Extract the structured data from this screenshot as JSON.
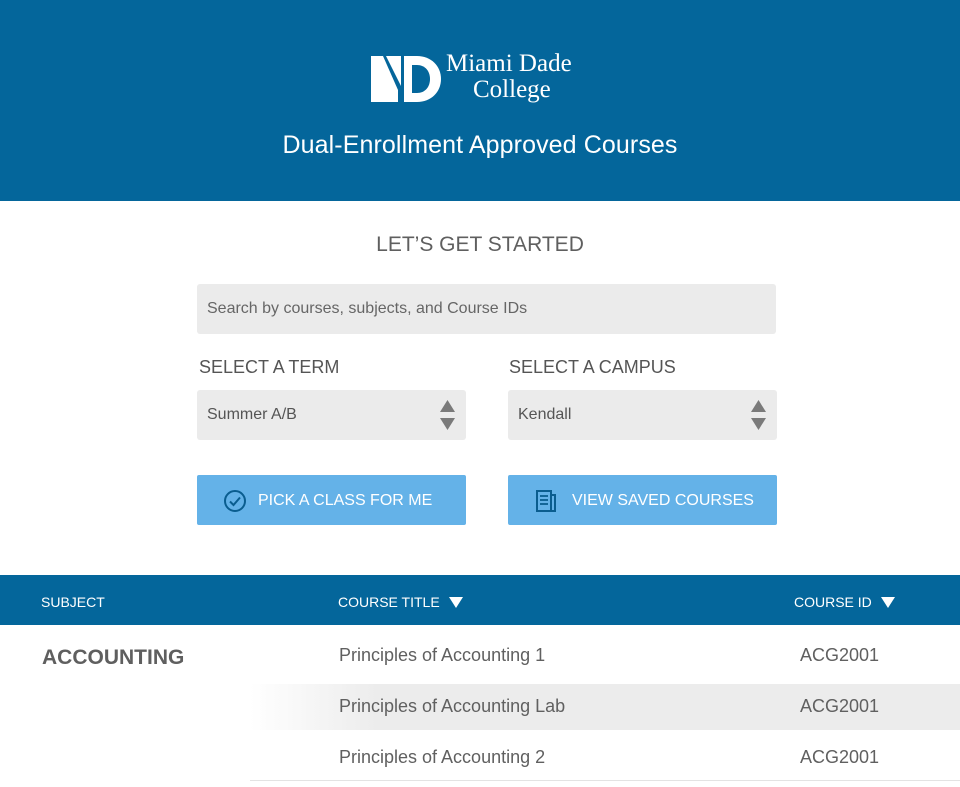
{
  "header": {
    "logo_line1": "Miami Dade",
    "logo_line2": "College",
    "title": "Dual-Enrollment Approved Courses",
    "background": "#04669b"
  },
  "intro": {
    "heading": "LET’S GET STARTED"
  },
  "search": {
    "placeholder": "Search by courses, subjects, and Course IDs",
    "value": ""
  },
  "term": {
    "label": "SELECT A TERM",
    "selected": "Summer A/B"
  },
  "campus": {
    "label": "SELECT A CAMPUS",
    "selected": "Kendall"
  },
  "buttons": {
    "pick": {
      "label": "PICK A CLASS FOR ME",
      "icon": "check-circle-icon"
    },
    "saved": {
      "label": "VIEW SAVED COURSES",
      "icon": "document-list-icon"
    },
    "color": "#64b2e8"
  },
  "table": {
    "columns": {
      "subject": "SUBJECT",
      "title": "COURSE TITLE",
      "id": "COURSE ID"
    },
    "groups": [
      {
        "subject": "ACCOUNTING",
        "rows": [
          {
            "title": "Principles of Accounting 1",
            "id": "ACG2001"
          },
          {
            "title": "Principles of Accounting Lab",
            "id": "ACG2001"
          },
          {
            "title": "Principles of Accounting 2",
            "id": "ACG2001"
          }
        ]
      }
    ]
  }
}
